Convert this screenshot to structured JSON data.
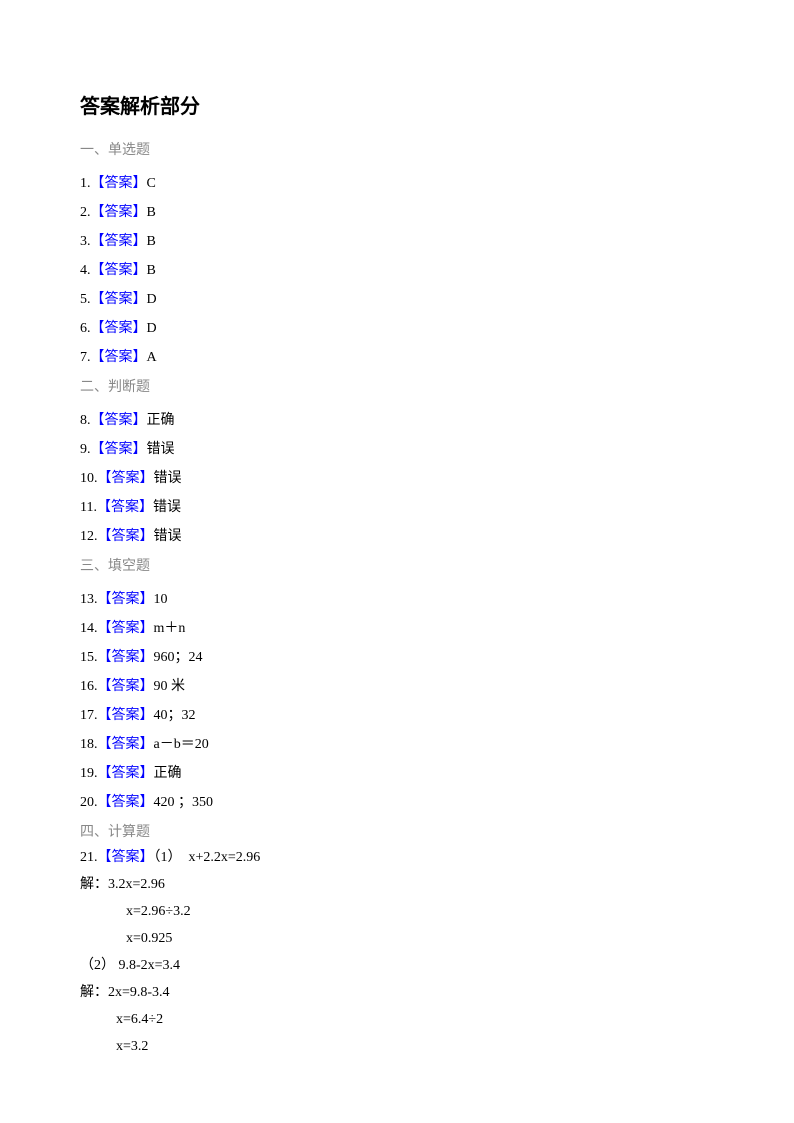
{
  "title": "答案解析部分",
  "sections": {
    "s1": {
      "header": "一、单选题",
      "items": [
        {
          "num": "1.",
          "tag": "【答案】",
          "value": "C"
        },
        {
          "num": "2.",
          "tag": "【答案】",
          "value": "B"
        },
        {
          "num": "3.",
          "tag": "【答案】",
          "value": "B"
        },
        {
          "num": "4.",
          "tag": "【答案】",
          "value": "B"
        },
        {
          "num": "5.",
          "tag": "【答案】",
          "value": "D"
        },
        {
          "num": "6.",
          "tag": "【答案】",
          "value": "D"
        },
        {
          "num": "7.",
          "tag": "【答案】",
          "value": "A"
        }
      ]
    },
    "s2": {
      "header": "二、判断题",
      "items": [
        {
          "num": "8.",
          "tag": "【答案】",
          "value": "正确"
        },
        {
          "num": "9.",
          "tag": "【答案】",
          "value": "错误"
        },
        {
          "num": "10.",
          "tag": "【答案】",
          "value": "错误"
        },
        {
          "num": "11.",
          "tag": "【答案】",
          "value": "错误"
        },
        {
          "num": "12.",
          "tag": "【答案】",
          "value": "错误"
        }
      ]
    },
    "s3": {
      "header": "三、填空题",
      "items": [
        {
          "num": "13.",
          "tag": "【答案】",
          "value": "10"
        },
        {
          "num": "14.",
          "tag": "【答案】",
          "value": "m＋n"
        },
        {
          "num": "15.",
          "tag": "【答案】",
          "value": "960；24"
        },
        {
          "num": "16.",
          "tag": "【答案】",
          "value": "90 米"
        },
        {
          "num": "17.",
          "tag": "【答案】",
          "value": "40；32"
        },
        {
          "num": "18.",
          "tag": "【答案】",
          "value": "a－b＝20"
        },
        {
          "num": "19.",
          "tag": "【答案】",
          "value": "正确"
        },
        {
          "num": "20.",
          "tag": "【答案】",
          "value": "420 ；350"
        }
      ]
    },
    "s4": {
      "header": "四、计算题",
      "q21": {
        "num": "21.",
        "tag": "【答案】",
        "part1_label": "（1）",
        "part1_eq": "x+2.2x=2.96",
        "solve_label": "解：",
        "p1_line1": "3.2x=2.96",
        "p1_line2": "x=2.96÷3.2",
        "p1_line3": "x=0.925",
        "part2_label": "（2）",
        "part2_eq": "9.8-2x=3.4",
        "p2_line1": "2x=9.8-3.4",
        "p2_line2": "x=6.4÷2",
        "p2_line3": "x=3.2"
      }
    }
  }
}
